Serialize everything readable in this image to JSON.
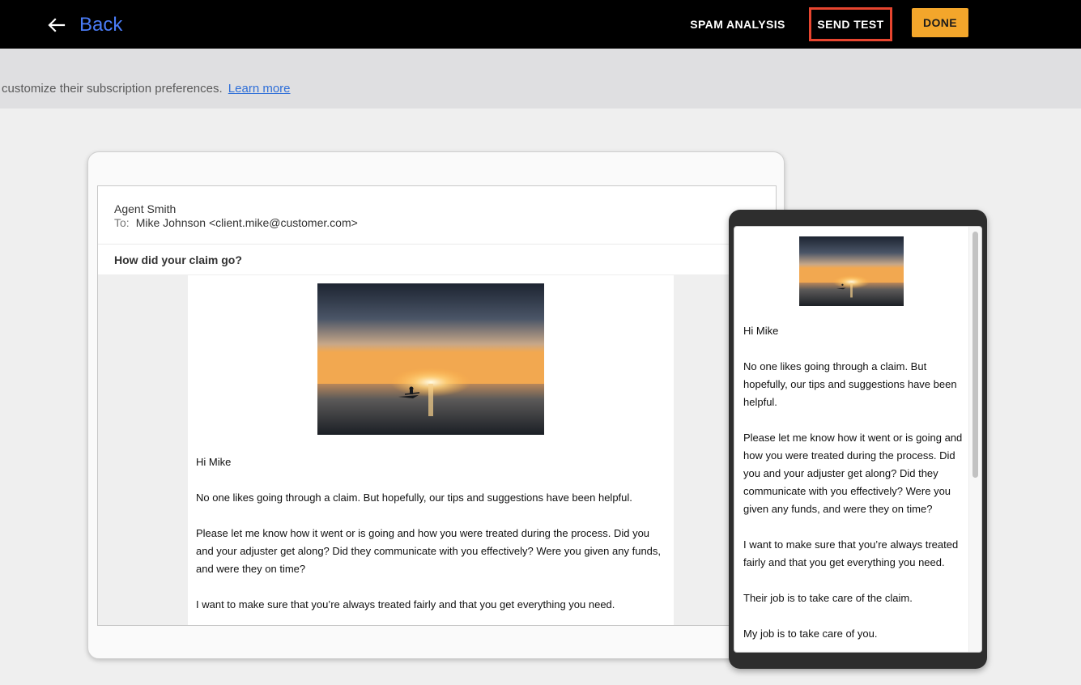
{
  "header": {
    "back_label": "Back",
    "spam_label": "SPAM ANALYSIS",
    "send_test_label": "SEND TEST",
    "done_label": "DONE"
  },
  "notice": {
    "text": "customize their subscription preferences.",
    "link": "Learn more"
  },
  "email": {
    "from": "Agent Smith",
    "to_label": "To:",
    "to": "Mike Johnson <client.mike@customer.com>",
    "subject": "How did your claim go?",
    "greeting": "Hi Mike",
    "paragraphs": [
      "No one likes going through a claim. But hopefully, our tips and suggestions have been helpful.",
      "Please let me know how it went or is going and how you were treated during the process. Did you and your adjuster get along? Did they communicate with you effectively? Were you given any funds, and were they on time?",
      "I want to make sure that you’re always treated fairly and that you get everything you need.",
      "Their job is to take care of the claim.",
      "My job is to take care of you."
    ]
  },
  "colors": {
    "accent_blue": "#4a7cf7",
    "done_orange": "#f3a62b",
    "highlight_red": "#e7452f"
  }
}
